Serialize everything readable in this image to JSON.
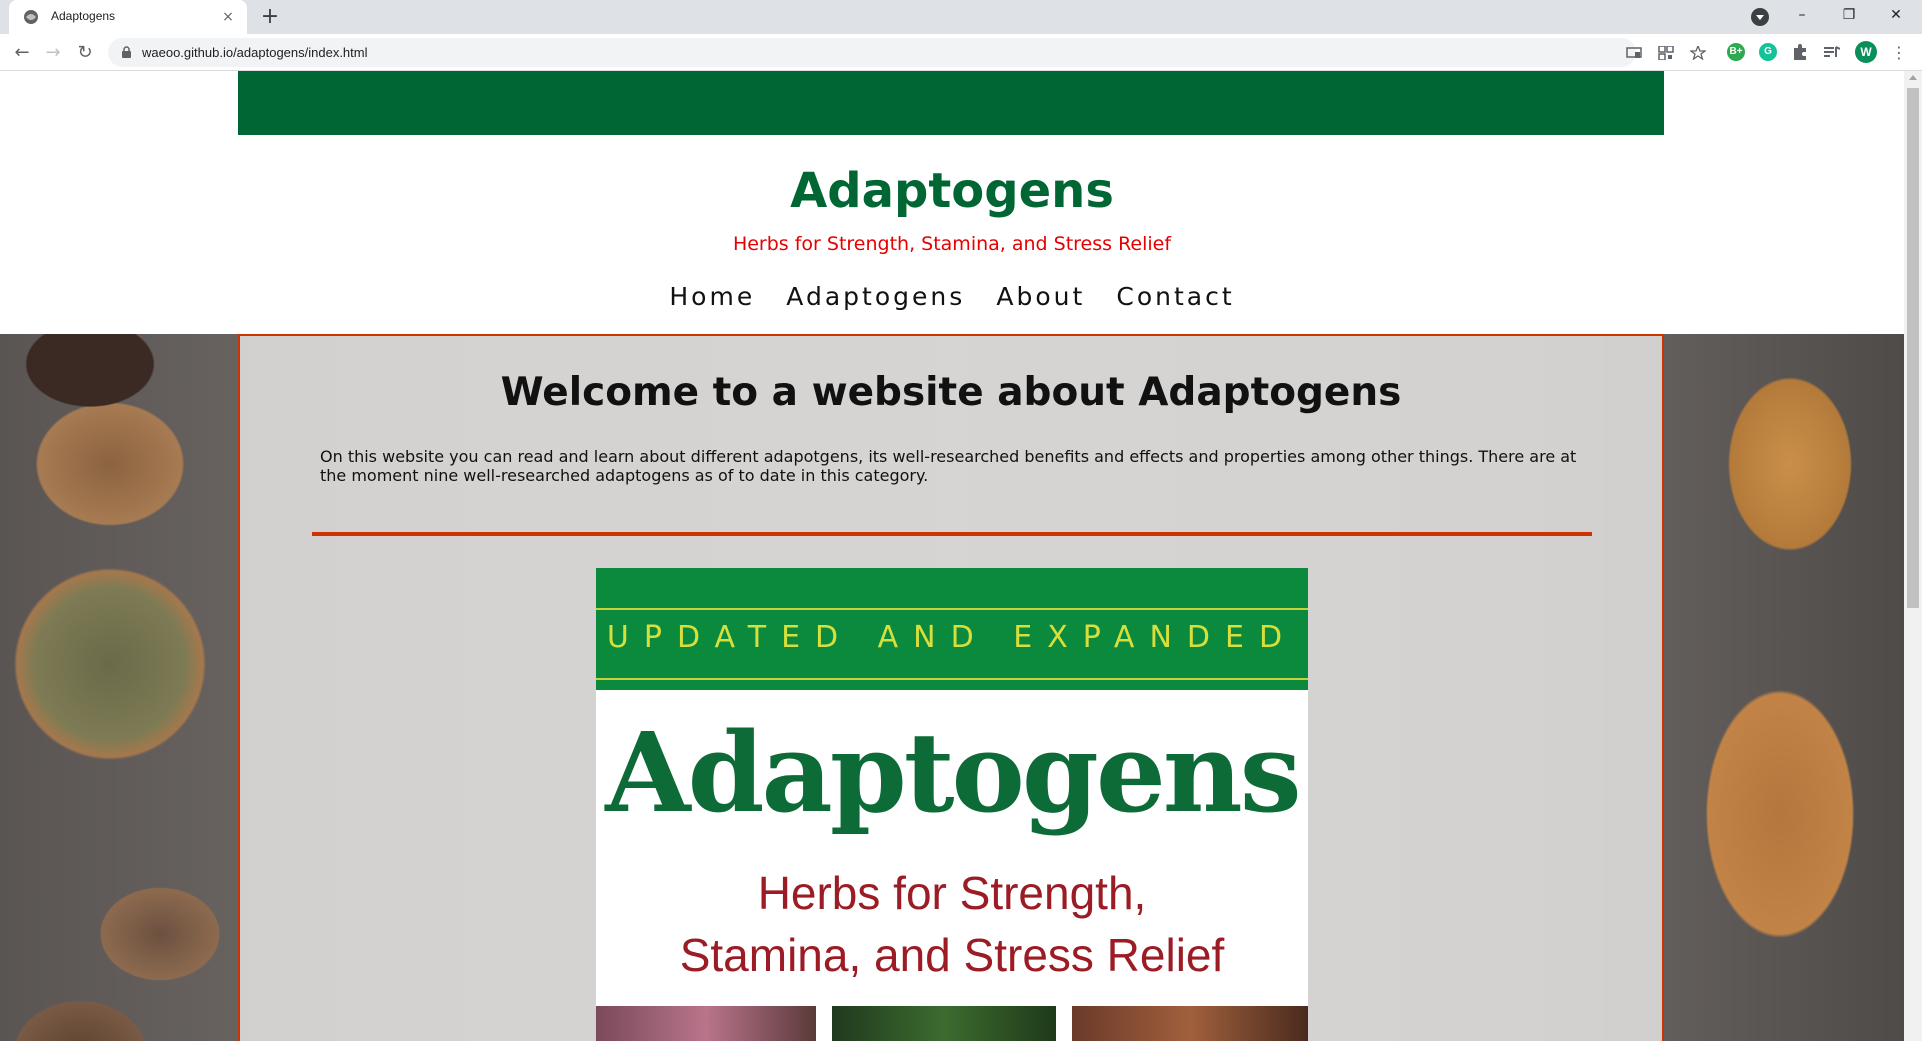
{
  "browser": {
    "tab_title": "Adaptogens",
    "tab_close": "×",
    "new_tab": "+",
    "url": "waeoo.github.io/adaptogens/index.html",
    "profile_initial": "W",
    "extensions": [
      "B+",
      "G"
    ],
    "window_controls": {
      "minimize": "–",
      "restore": "❐",
      "close": "✕"
    },
    "nav": {
      "back": "←",
      "forward": "→",
      "reload": "↻",
      "menu": "⋮"
    }
  },
  "site": {
    "title": "Adaptogens",
    "subtitle": "Herbs for Strength, Stamina, and Stress Relief",
    "nav": [
      "Home",
      "Adaptogens",
      "About",
      "Contact"
    ],
    "colors": {
      "brand_green": "#006633",
      "accent_red": "#e60000",
      "border_orange": "#cc3300"
    }
  },
  "main": {
    "heading": "Welcome to a website about Adaptogens",
    "intro": "On this website you can read and learn about different adapotgens, its well-researched benefits and effects and properties among other things. There are at the moment nine well-researched adaptogens as of to date in this category."
  },
  "cover": {
    "tagline": "UPDATED AND EXPANDED",
    "title": "Adaptogens",
    "subtitle_line1": "Herbs for Strength,",
    "subtitle_line2": "Stamina, and Stress Relief"
  }
}
